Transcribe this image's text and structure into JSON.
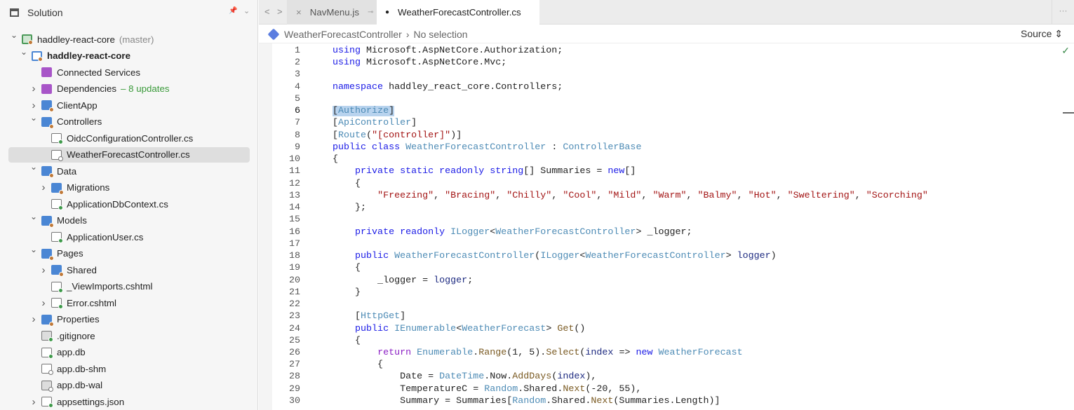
{
  "sidebar": {
    "title": "Solution",
    "items": [
      {
        "label": "haddley-react-core",
        "sub": "(master)",
        "level": 0,
        "chev": "down",
        "icon": "sln",
        "badge": "or"
      },
      {
        "label": "haddley-react-core",
        "level": 1,
        "chev": "down",
        "icon": "proj",
        "badge": "or",
        "bold": true
      },
      {
        "label": "Connected Services",
        "level": 2,
        "icon": "folder-purple"
      },
      {
        "label": "Dependencies",
        "upd": "– 8 updates",
        "level": 2,
        "chev": "right",
        "icon": "folder-purple"
      },
      {
        "label": "ClientApp",
        "level": 2,
        "chev": "right",
        "icon": "folder",
        "badge": "or"
      },
      {
        "label": "Controllers",
        "level": 2,
        "chev": "down",
        "icon": "folder",
        "badge": "or"
      },
      {
        "label": "OidcConfigurationController.cs",
        "level": 3,
        "icon": "file",
        "badge": "gr"
      },
      {
        "label": "WeatherForecastController.cs",
        "level": 3,
        "icon": "file",
        "badge": "gy",
        "selected": true
      },
      {
        "label": "Data",
        "level": 2,
        "chev": "down",
        "icon": "folder",
        "badge": "or"
      },
      {
        "label": "Migrations",
        "level": 3,
        "chev": "right",
        "icon": "folder",
        "badge": "or"
      },
      {
        "label": "ApplicationDbContext.cs",
        "level": 3,
        "icon": "file",
        "badge": "gr"
      },
      {
        "label": "Models",
        "level": 2,
        "chev": "down",
        "icon": "folder",
        "badge": "or"
      },
      {
        "label": "ApplicationUser.cs",
        "level": 3,
        "icon": "file",
        "badge": "gr"
      },
      {
        "label": "Pages",
        "level": 2,
        "chev": "down",
        "icon": "folder",
        "badge": "or"
      },
      {
        "label": "Shared",
        "level": 3,
        "chev": "right",
        "icon": "folder",
        "badge": "or"
      },
      {
        "label": "_ViewImports.cshtml",
        "level": 3,
        "icon": "file",
        "badge": "gr"
      },
      {
        "label": "Error.cshtml",
        "level": 3,
        "chev": "right",
        "icon": "file",
        "badge": "gr"
      },
      {
        "label": "Properties",
        "level": 2,
        "chev": "right",
        "icon": "folder",
        "badge": "or"
      },
      {
        "label": ".gitignore",
        "level": 2,
        "icon": "file-dark",
        "badge": "gr"
      },
      {
        "label": "app.db",
        "level": 2,
        "icon": "file",
        "badge": "gr"
      },
      {
        "label": "app.db-shm",
        "level": 2,
        "icon": "file",
        "badge": "gy"
      },
      {
        "label": "app.db-wal",
        "level": 2,
        "icon": "file-dark",
        "badge": "gy"
      },
      {
        "label": "appsettings.json",
        "level": 2,
        "chev": "right",
        "icon": "file",
        "badge": "gr"
      }
    ]
  },
  "tabs": [
    {
      "label": "NavMenu.js"
    },
    {
      "label": "WeatherForecastController.cs",
      "modified": true
    }
  ],
  "breadcrumb": {
    "class": "WeatherForecastController",
    "sep": "›",
    "member": "No selection"
  },
  "source_label": "Source",
  "code": [
    [
      [
        "kw",
        "using"
      ],
      [
        "pl",
        " Microsoft.AspNetCore.Authorization;"
      ]
    ],
    [
      [
        "kw",
        "using"
      ],
      [
        "pl",
        " Microsoft.AspNetCore.Mvc;"
      ]
    ],
    [],
    [
      [
        "kw",
        "namespace"
      ],
      [
        "pl",
        " haddley_react_core.Controllers;"
      ]
    ],
    [],
    [
      [
        "hlpl",
        "["
      ],
      [
        "hlty",
        "Authorize"
      ],
      [
        "hlpl",
        "]"
      ]
    ],
    [
      [
        "pl",
        "["
      ],
      [
        "ty",
        "ApiController"
      ],
      [
        "pl",
        "]"
      ]
    ],
    [
      [
        "pl",
        "["
      ],
      [
        "ty",
        "Route"
      ],
      [
        "pl",
        "("
      ],
      [
        "st",
        "\"[controller]\""
      ],
      [
        "pl",
        ")]"
      ]
    ],
    [
      [
        "kw",
        "public class"
      ],
      [
        "pl",
        " "
      ],
      [
        "ty",
        "WeatherForecastController"
      ],
      [
        "pl",
        " : "
      ],
      [
        "ty",
        "ControllerBase"
      ]
    ],
    [
      [
        "pl",
        "{"
      ]
    ],
    [
      [
        "pl",
        "    "
      ],
      [
        "kw",
        "private static readonly string"
      ],
      [
        "pl",
        "[] Summaries = "
      ],
      [
        "kw",
        "new"
      ],
      [
        "pl",
        "[]"
      ]
    ],
    [
      [
        "pl",
        "    {"
      ]
    ],
    [
      [
        "pl",
        "        "
      ],
      [
        "st",
        "\"Freezing\""
      ],
      [
        "pl",
        ", "
      ],
      [
        "st",
        "\"Bracing\""
      ],
      [
        "pl",
        ", "
      ],
      [
        "st",
        "\"Chilly\""
      ],
      [
        "pl",
        ", "
      ],
      [
        "st",
        "\"Cool\""
      ],
      [
        "pl",
        ", "
      ],
      [
        "st",
        "\"Mild\""
      ],
      [
        "pl",
        ", "
      ],
      [
        "st",
        "\"Warm\""
      ],
      [
        "pl",
        ", "
      ],
      [
        "st",
        "\"Balmy\""
      ],
      [
        "pl",
        ", "
      ],
      [
        "st",
        "\"Hot\""
      ],
      [
        "pl",
        ", "
      ],
      [
        "st",
        "\"Sweltering\""
      ],
      [
        "pl",
        ", "
      ],
      [
        "st",
        "\"Scorching\""
      ]
    ],
    [
      [
        "pl",
        "    };"
      ]
    ],
    [],
    [
      [
        "pl",
        "    "
      ],
      [
        "kw",
        "private readonly"
      ],
      [
        "pl",
        " "
      ],
      [
        "ty",
        "ILogger"
      ],
      [
        "pl",
        "<"
      ],
      [
        "ty",
        "WeatherForecastController"
      ],
      [
        "pl",
        "> _logger;"
      ]
    ],
    [],
    [
      [
        "pl",
        "    "
      ],
      [
        "kw",
        "public"
      ],
      [
        "pl",
        " "
      ],
      [
        "ty",
        "WeatherForecastController"
      ],
      [
        "pl",
        "("
      ],
      [
        "ty",
        "ILogger"
      ],
      [
        "pl",
        "<"
      ],
      [
        "ty",
        "WeatherForecastController"
      ],
      [
        "pl",
        "> "
      ],
      [
        "pa",
        "logger"
      ],
      [
        "pl",
        ")"
      ]
    ],
    [
      [
        "pl",
        "    {"
      ]
    ],
    [
      [
        "pl",
        "        _logger = "
      ],
      [
        "pa",
        "logger"
      ],
      [
        "pl",
        ";"
      ]
    ],
    [
      [
        "pl",
        "    }"
      ]
    ],
    [],
    [
      [
        "pl",
        "    ["
      ],
      [
        "ty",
        "HttpGet"
      ],
      [
        "pl",
        "]"
      ]
    ],
    [
      [
        "pl",
        "    "
      ],
      [
        "kw",
        "public"
      ],
      [
        "pl",
        " "
      ],
      [
        "ty",
        "IEnumerable"
      ],
      [
        "pl",
        "<"
      ],
      [
        "ty",
        "WeatherForecast"
      ],
      [
        "pl",
        "> "
      ],
      [
        "me",
        "Get"
      ],
      [
        "pl",
        "()"
      ]
    ],
    [
      [
        "pl",
        "    {"
      ]
    ],
    [
      [
        "pl",
        "        "
      ],
      [
        "ct",
        "return"
      ],
      [
        "pl",
        " "
      ],
      [
        "ty",
        "Enumerable"
      ],
      [
        "pl",
        "."
      ],
      [
        "me",
        "Range"
      ],
      [
        "pl",
        "(1, 5)."
      ],
      [
        "me",
        "Select"
      ],
      [
        "pl",
        "("
      ],
      [
        "pa",
        "index"
      ],
      [
        "pl",
        " => "
      ],
      [
        "kw",
        "new"
      ],
      [
        "pl",
        " "
      ],
      [
        "ty",
        "WeatherForecast"
      ]
    ],
    [
      [
        "pl",
        "        {"
      ]
    ],
    [
      [
        "pl",
        "            Date = "
      ],
      [
        "ty",
        "DateTime"
      ],
      [
        "pl",
        ".Now."
      ],
      [
        "me",
        "AddDays"
      ],
      [
        "pl",
        "("
      ],
      [
        "pa",
        "index"
      ],
      [
        "pl",
        "),"
      ]
    ],
    [
      [
        "pl",
        "            TemperatureC = "
      ],
      [
        "ty",
        "Random"
      ],
      [
        "pl",
        ".Shared."
      ],
      [
        "me",
        "Next"
      ],
      [
        "pl",
        "(-20, 55),"
      ]
    ],
    [
      [
        "pl",
        "            Summary = Summaries["
      ],
      [
        "ty",
        "Random"
      ],
      [
        "pl",
        ".Shared."
      ],
      [
        "me",
        "Next"
      ],
      [
        "pl",
        "(Summaries.Length)]"
      ]
    ]
  ],
  "current_line": 6,
  "colors": {
    "accent": "#4a86d4",
    "updates": "#3a9a3a",
    "selection": "#b8d3ee"
  }
}
